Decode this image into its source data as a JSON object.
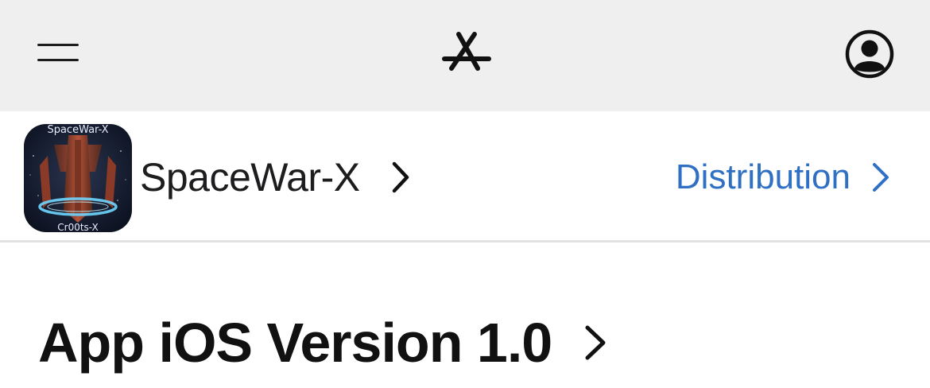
{
  "header": {
    "menu_icon": "hamburger-icon",
    "logo_icon": "app-store-icon",
    "account_icon": "account-icon"
  },
  "app": {
    "name": "SpaceWar-X",
    "icon_top_text": "SpaceWar-X",
    "icon_bottom_text": "Cr00ts-X",
    "distribution_label": "Distribution"
  },
  "version": {
    "title": "App iOS Version 1.0"
  },
  "colors": {
    "topbar_bg": "#efefef",
    "link_blue": "#2f6fc4",
    "text_dark": "#1d1d1f"
  }
}
